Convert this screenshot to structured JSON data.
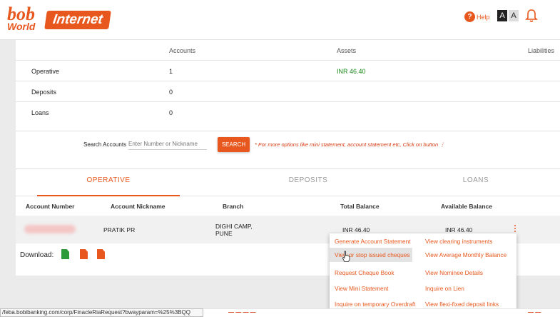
{
  "header": {
    "logo_bob": "bob",
    "logo_world": "World",
    "logo_internet": "Internet",
    "help_symbol": "?",
    "help_label": "Help",
    "font_size_large": "A",
    "font_size_small": "A",
    "icons": [
      "help-icon",
      "bell-icon"
    ]
  },
  "summary": {
    "headers": {
      "accounts": "Accounts",
      "assets": "Assets",
      "liabilities": "Liabilities"
    },
    "rows": [
      {
        "label": "Operative",
        "accounts": "1",
        "assets": "INR 46.40"
      },
      {
        "label": "Deposits",
        "accounts": "0",
        "assets": ""
      },
      {
        "label": "Loans",
        "accounts": "0",
        "assets": ""
      }
    ]
  },
  "search": {
    "label": "Search Accounts",
    "placeholder": "Enter Number or Nickname",
    "button": "SEARCH",
    "note": "* For more options like mini statement, account statement etc, Click on button ⋮"
  },
  "tabs": [
    {
      "label": "OPERATIVE",
      "active": true
    },
    {
      "label": "DEPOSITS",
      "active": false
    },
    {
      "label": "LOANS",
      "active": false
    }
  ],
  "table": {
    "headers": [
      "Account Number",
      "Account Nickname",
      "Branch",
      "Total Balance",
      "Available Balance"
    ],
    "row": {
      "nickname": "PRATIK PR",
      "branch_line1": "DIGHI CAMP,",
      "branch_line2": "PUNE",
      "total_balance": "INR 46.40",
      "available_balance": "INR 46.40"
    }
  },
  "download": {
    "label": "Download:",
    "icons": [
      "excel-icon",
      "pdf-icon",
      "file-icon"
    ]
  },
  "context_menu": {
    "items": [
      "Generate Account Statement",
      "View clearing instruments",
      "View or stop issued cheques",
      "View Average Monthly Balance",
      "Request Cheque Book",
      "View Nominee Details",
      "View Mini Statement",
      "Inquire on Lien",
      "Inquire on temporary Overdraft",
      "View flexi-fixed deposit links"
    ]
  },
  "statusbar": {
    "url": "/feba.bobibanking.com/corp/FinacleRiaRequest?bwayparam=%25%3BQQ"
  },
  "colors": {
    "brand": "#e8581e",
    "positive": "#1a8a1a"
  }
}
